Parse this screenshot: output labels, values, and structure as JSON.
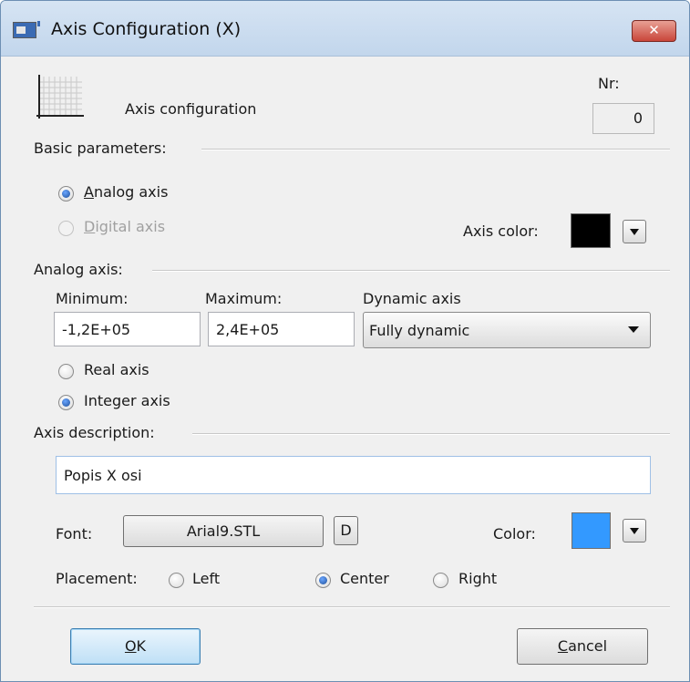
{
  "window": {
    "title": "Axis Configuration (X)",
    "close_label": "✕"
  },
  "header": {
    "label": "Axis configuration",
    "nr_label": "Nr:",
    "nr_value": "0"
  },
  "basic": {
    "group_label": "Basic parameters:",
    "analog_first": "A",
    "analog_rest": "nalog axis",
    "digital_first": "D",
    "digital_rest": "igital axis",
    "selected": "analog",
    "color_label": "Axis color:",
    "color": "#000000"
  },
  "analog": {
    "group_label": "Analog axis:",
    "min_label": "Minimum:",
    "min_value": "-1,2E+05",
    "max_label": "Maximum:",
    "max_value": "2,4E+05",
    "dynamic_label": "Dynamic axis",
    "dynamic_value": "Fully dynamic",
    "real_label": "Real axis",
    "integer_label": "Integer axis",
    "selected": "integer"
  },
  "description": {
    "group_label": "Axis description:",
    "text": "Popis X osi",
    "font_label": "Font:",
    "font_value": "Arial9.STL",
    "d_label": "D",
    "color_label": "Color:",
    "color": "#3399ff",
    "placement_label": "Placement:",
    "left_label": "Left",
    "center_label": "Center",
    "right_label": "Right",
    "placement": "center"
  },
  "footer": {
    "ok_first": "O",
    "ok_rest": "K",
    "cancel_first": "C",
    "cancel_rest": "ancel"
  },
  "icons": {
    "app": "app-window-icon",
    "axis": "axis-grid-icon",
    "close": "close-icon"
  }
}
